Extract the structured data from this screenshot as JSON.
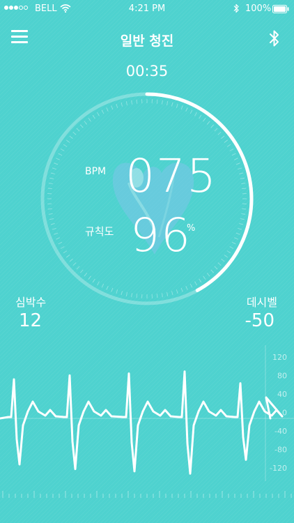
{
  "status_bar": {
    "carrier": "BELL",
    "time": "4:21 PM",
    "battery": "100%"
  },
  "nav": {
    "title": "일반 청진"
  },
  "timer": "00:35",
  "gauge": {
    "bpm_label": "BPM",
    "bpm_value": "075",
    "regularity_label": "규칙도",
    "regularity_value": "96",
    "regularity_unit": "%",
    "progress": 0.42
  },
  "stats": {
    "heart_rate_label": "심박수",
    "heart_rate_value": "12",
    "decibel_label": "데시벨",
    "decibel_value": "-50"
  },
  "ecg": {
    "y_ticks": [
      "120",
      "80",
      "40",
      "0",
      "-40",
      "-80",
      "-120"
    ]
  },
  "colors": {
    "background": "#4ed2cf",
    "foreground": "#ffffff"
  }
}
